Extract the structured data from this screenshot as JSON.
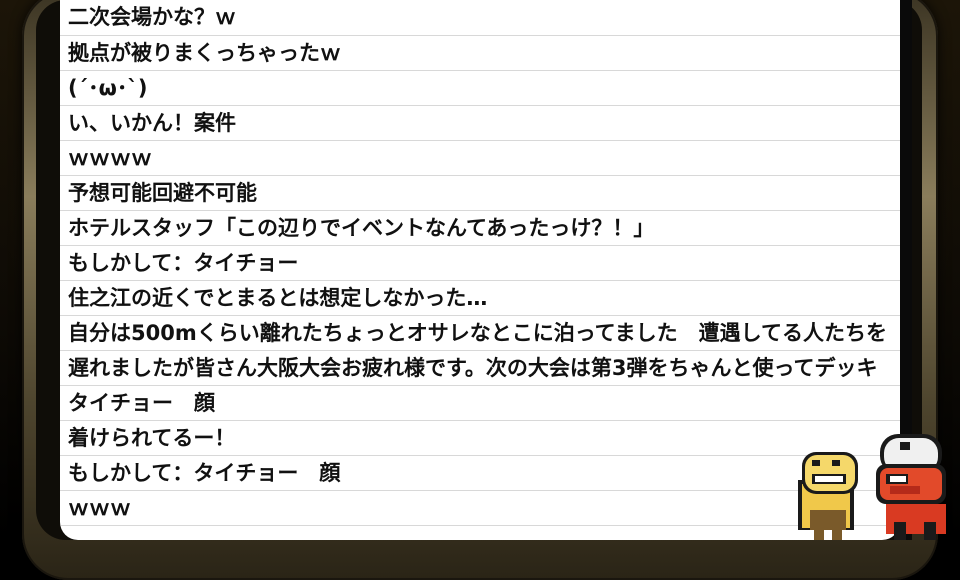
{
  "chat": {
    "messages": [
      "二次会場かな？ｗ",
      "拠点が被りまくっちゃったｗ",
      "(´･ω･`)",
      "い、いかん！案件",
      "ｗｗｗｗ",
      "予想可能回避不可能",
      "ホテルスタッフ「この辺りでイベントなんてあったっけ？！」",
      "もしかして：タイチョー",
      "住之江の近くでとまるとは想定しなかった…",
      "自分は500mくらい離れたちょっとオサレなとこに泊ってました　遭遇してる人たちを",
      "遅れましたが皆さん大阪大会お疲れ様です。次の大会は第3弾をちゃんと使ってデッキ",
      "タイチョー　顔",
      "着けられてるー！",
      "もしかして：タイチョー　顔",
      "ｗｗｗ"
    ]
  },
  "colors": {
    "chat_bg": "#ffffff",
    "frame_gold": "#8a7d5b",
    "text": "#111111"
  },
  "icons": [
    "yellow-mascot-icon",
    "red-mascot-icon"
  ]
}
